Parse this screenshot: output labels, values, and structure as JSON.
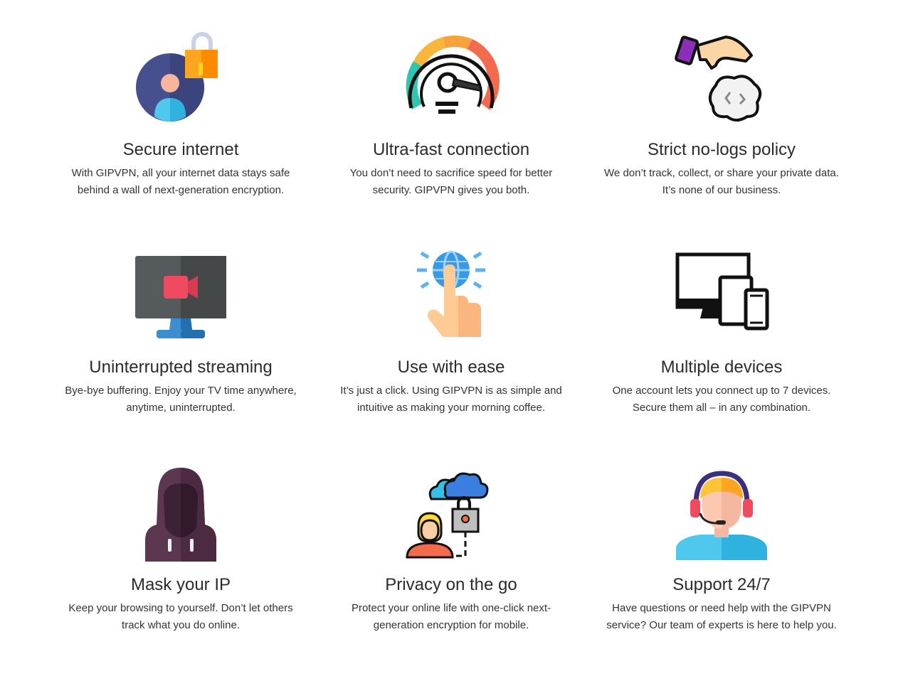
{
  "features": [
    {
      "icon": "secure-internet-icon",
      "title": "Secure internet",
      "desc_line1": "With GIPVPN, all your internet data stays safe",
      "desc_line2": "behind a wall of next-generation encryption."
    },
    {
      "icon": "speedometer-icon",
      "title": "Ultra-fast connection",
      "desc_line1": "You don’t need to sacrifice speed for better",
      "desc_line2": "security. GIPVPN gives you both."
    },
    {
      "icon": "no-logs-icon",
      "title": "Strict no-logs policy",
      "desc_line1": "We don’t track, collect, or share your private data.",
      "desc_line2": "It’s none of our business."
    },
    {
      "icon": "streaming-monitor-icon",
      "title": "Uninterrupted streaming",
      "desc_line1": "Bye-bye buffering. Enjoy your TV time anywhere,",
      "desc_line2": "anytime, uninterrupted."
    },
    {
      "icon": "click-globe-icon",
      "title": "Use with ease",
      "desc_line1": "It’s just a click. Using GIPVPN is as simple and",
      "desc_line2": "intuitive as making your morning coffee."
    },
    {
      "icon": "multiple-devices-icon",
      "title": "Multiple devices",
      "desc_line1": "One account lets you connect up to 7 devices.",
      "desc_line2": "Secure them all – in any combination."
    },
    {
      "icon": "hooded-figure-icon",
      "title": "Mask your IP",
      "desc_line1": "Keep your browsing to yourself. Don’t let others",
      "desc_line2": "track what you do online."
    },
    {
      "icon": "cloud-lock-user-icon",
      "title": "Privacy on the go",
      "desc_line1": "Protect your online life with one-click next-",
      "desc_line2": "generation encryption for mobile."
    },
    {
      "icon": "support-agent-icon",
      "title": "Support 24/7",
      "desc_line1": "Have questions or need help with the GIPVPN",
      "desc_line2": "service? Our team of experts is here to help you."
    }
  ]
}
